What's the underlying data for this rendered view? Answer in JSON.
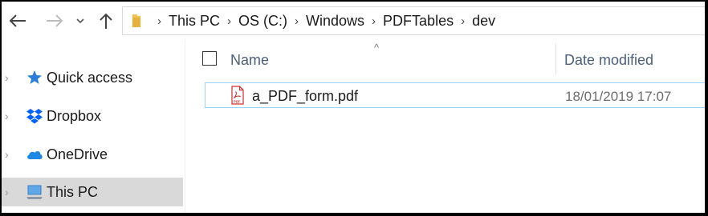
{
  "nav": {
    "back_icon": "arrow-left-icon",
    "forward_icon": "arrow-right-icon",
    "recent_icon": "chevron-down-icon",
    "up_icon": "arrow-up-icon"
  },
  "address": {
    "folder_icon": "folder-icon",
    "breadcrumbs": [
      "This PC",
      "OS (C:)",
      "Windows",
      "PDFTables",
      "dev"
    ]
  },
  "sidebar": {
    "items": [
      {
        "label": "Quick access",
        "icon": "star-icon",
        "selected": false
      },
      {
        "label": "Dropbox",
        "icon": "dropbox-icon",
        "selected": false
      },
      {
        "label": "OneDrive",
        "icon": "cloud-icon",
        "selected": false
      },
      {
        "label": "This PC",
        "icon": "computer-icon",
        "selected": true
      }
    ]
  },
  "list": {
    "columns": {
      "name": "Name",
      "date": "Date modified"
    },
    "sort_indicator": "^",
    "files": [
      {
        "name": "a_PDF_form.pdf",
        "date_modified": "18/01/2019 17:07",
        "icon": "pdf-file-icon",
        "icon_text": "PDF"
      }
    ]
  },
  "colors": {
    "selection_bg": "#d9d9d9",
    "row_border": "#99d1ff",
    "header_text": "#4c607a",
    "accent_blue": "#1e88e5",
    "pdf_red": "#d32f2f"
  }
}
